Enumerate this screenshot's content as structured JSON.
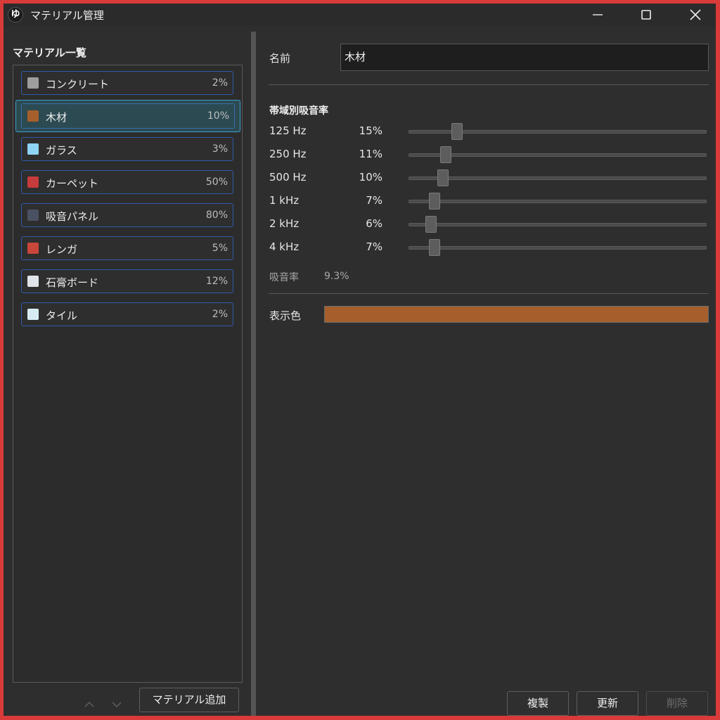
{
  "window": {
    "title": "マテリアル管理",
    "app_icon_text": "ゆ"
  },
  "material_list": {
    "title": "マテリアル一覧",
    "items": [
      {
        "name": "コンクリート",
        "percent": "2%",
        "color": "#9e9e9e"
      },
      {
        "name": "木材",
        "percent": "10%",
        "color": "#a65f2c",
        "selected": true
      },
      {
        "name": "ガラス",
        "percent": "3%",
        "color": "#8fd4f4"
      },
      {
        "name": "カーペット",
        "percent": "50%",
        "color": "#c63b3b"
      },
      {
        "name": "吸音パネル",
        "percent": "80%",
        "color": "#4a5163"
      },
      {
        "name": "レンガ",
        "percent": "5%",
        "color": "#c8463a"
      },
      {
        "name": "石膏ボード",
        "percent": "12%",
        "color": "#dfe4ea"
      },
      {
        "name": "タイル",
        "percent": "2%",
        "color": "#d6ecf2"
      }
    ],
    "add_button": "マテリアル追加"
  },
  "detail": {
    "name_label": "名前",
    "name_value": "木材",
    "bands_title": "帯域別吸音率",
    "bands": [
      {
        "label": "125 Hz",
        "value": "15%",
        "level": 0.15
      },
      {
        "label": "250 Hz",
        "value": "11%",
        "level": 0.11
      },
      {
        "label": "500 Hz",
        "value": "10%",
        "level": 0.1
      },
      {
        "label": "1 kHz",
        "value": "7%",
        "level": 0.07
      },
      {
        "label": "2 kHz",
        "value": "6%",
        "level": 0.06
      },
      {
        "label": "4 kHz",
        "value": "7%",
        "level": 0.07
      }
    ],
    "absorption_label": "吸音率",
    "absorption_value": "9.3%",
    "color_label": "表示色",
    "color_value": "#a65f2c"
  },
  "actions": {
    "duplicate": "複製",
    "update": "更新",
    "delete": "削除"
  }
}
